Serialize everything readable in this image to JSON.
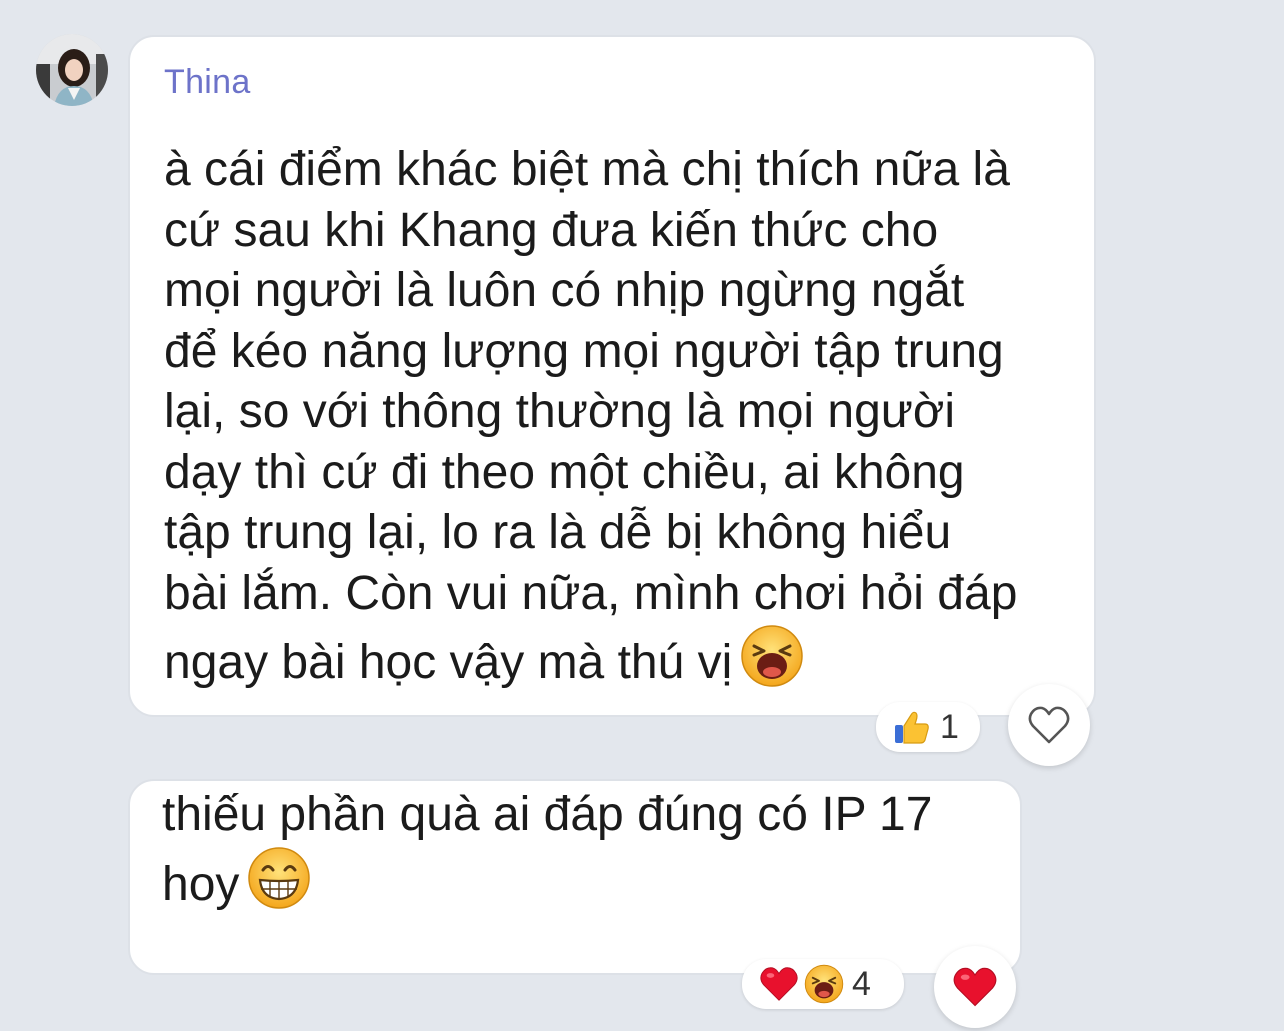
{
  "message1": {
    "sender": "Thina",
    "lines": [
      "à cái điểm khác biệt mà chị thích nữa là",
      "cứ sau khi Khang đưa kiến thức cho",
      "mọi người là luôn có nhịp ngừng ngắt",
      "để kéo năng lượng mọi người tập trung",
      "lại, so với thông thường là mọi người",
      "dạy thì cứ đi theo một chiều, ai không",
      "tập trung lại, lo ra là dễ bị không hiểu",
      "bài lắm. Còn vui nữa, mình chơi hỏi đáp",
      "ngay bài học vậy mà thú vị"
    ],
    "trailing_emoji": "laughing-face-icon",
    "reactions": {
      "emojis": [
        "thumbs-up-icon"
      ],
      "count": "1"
    },
    "reaction_button_icon": "heart-outline-icon"
  },
  "message2": {
    "lines": [
      "thiếu phần quà ai đáp đúng có IP 17",
      "hoy"
    ],
    "trailing_emoji": "grinning-face-icon",
    "reactions": {
      "emojis": [
        "red-heart-icon",
        "laughing-face-icon"
      ],
      "count": "4"
    },
    "reaction_button_icon": "red-heart-icon"
  },
  "colors": {
    "background": "#e3e7ed",
    "bubble": "#ffffff",
    "sender_name": "#6d73c9",
    "text": "#1b1b1b",
    "heart": "#e8112d"
  }
}
